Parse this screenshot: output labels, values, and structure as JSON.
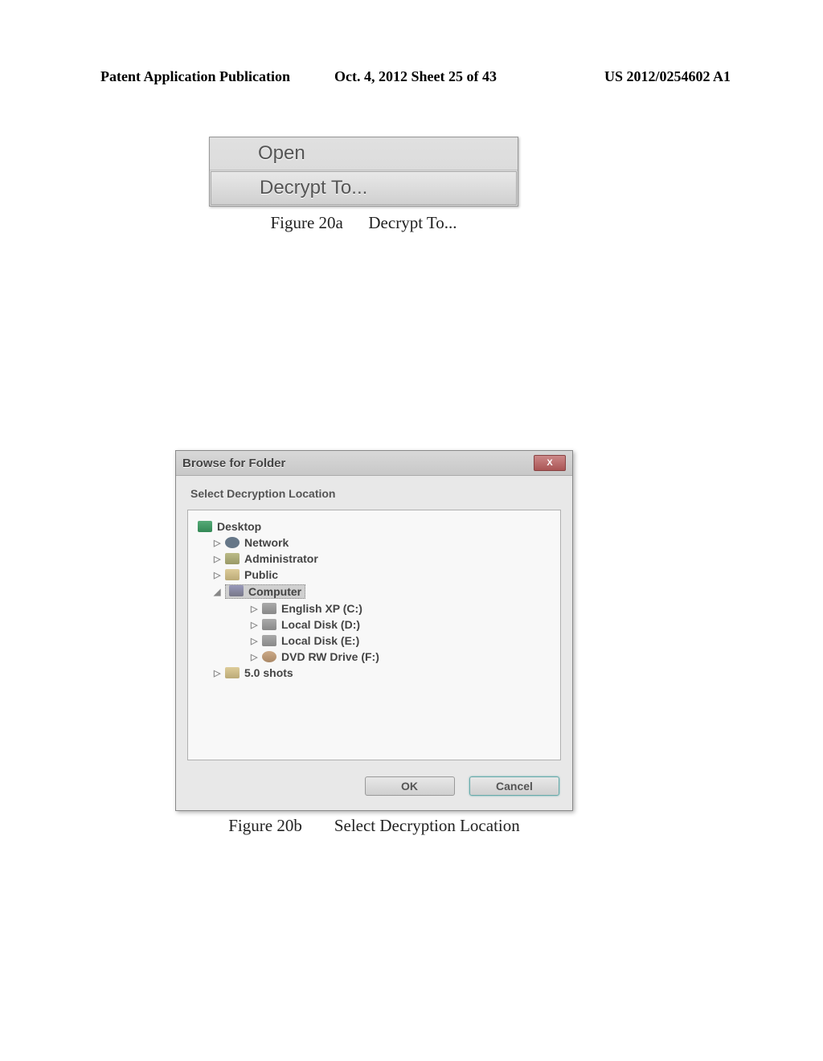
{
  "header": {
    "left": "Patent Application Publication",
    "mid": "Oct. 4, 2012   Sheet 25 of 43",
    "right": "US 2012/0254602 A1"
  },
  "fig20a": {
    "menu": {
      "open": "Open",
      "decrypt": "Decrypt To..."
    },
    "caption_label": "Figure 20a",
    "caption_text": "Decrypt To..."
  },
  "fig20b": {
    "title": "Browse for Folder",
    "close_glyph": "X",
    "subtitle": "Select Decryption Location",
    "tree": {
      "desktop": "Desktop",
      "network": "Network",
      "administrator": "Administrator",
      "public": "Public",
      "computer": "Computer",
      "drive_c": "English XP (C:)",
      "drive_d": "Local Disk (D:)",
      "drive_e": "Local Disk (E:)",
      "drive_f": "DVD RW Drive (F:)",
      "shots": "5.0 shots"
    },
    "expander_closed": "▷",
    "expander_open": "◢",
    "ok": "OK",
    "cancel": "Cancel",
    "caption_label": "Figure 20b",
    "caption_text": "Select Decryption Location"
  }
}
